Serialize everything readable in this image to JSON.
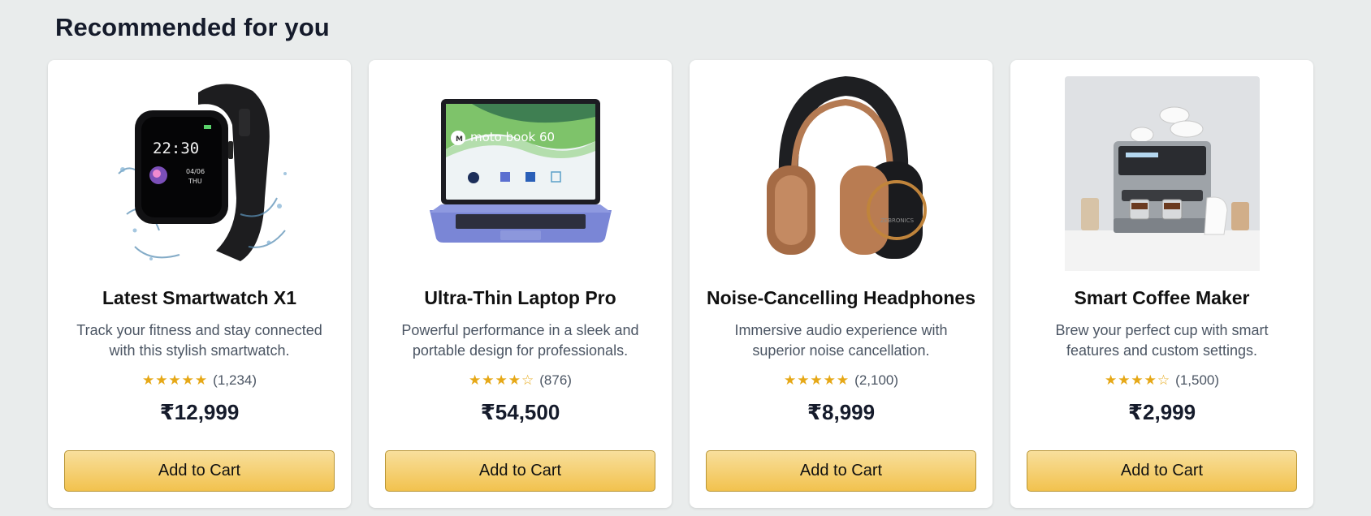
{
  "section": {
    "title": "Recommended for you"
  },
  "products": [
    {
      "image_icon": "smartwatch-image",
      "image_text": {
        "time": "22:30",
        "date": "04/06",
        "day": "THU"
      },
      "title": "Latest Smartwatch X1",
      "description": "Track your fitness and stay connected with this stylish smartwatch.",
      "stars": "★★★★★",
      "reviews": "(1,234)",
      "price": "₹12,999",
      "button": "Add to Cart"
    },
    {
      "image_icon": "laptop-image",
      "image_text": {
        "brand": "moto book 60"
      },
      "title": "Ultra-Thin Laptop Pro",
      "description": "Powerful performance in a sleek and portable design for professionals.",
      "stars": "★★★★☆",
      "reviews": "(876)",
      "price": "₹54,500",
      "button": "Add to Cart"
    },
    {
      "image_icon": "headphones-image",
      "image_text": {
        "brand": "ZEBRONICS"
      },
      "title": "Noise-Cancelling Headphones",
      "description": "Immersive audio experience with superior noise cancellation.",
      "stars": "★★★★★",
      "reviews": "(2,100)",
      "price": "₹8,999",
      "button": "Add to Cart"
    },
    {
      "image_icon": "coffee-maker-image",
      "title": "Smart Coffee Maker",
      "description": "Brew your perfect cup with smart features and custom settings.",
      "stars": "★★★★☆",
      "reviews": "(1,500)",
      "price": "₹2,999",
      "button": "Add to Cart"
    }
  ],
  "colors": {
    "background": "#e9ecec",
    "card": "#ffffff",
    "star": "#e6a817",
    "button_top": "#f8df9c",
    "button_bottom": "#f2c24e"
  }
}
